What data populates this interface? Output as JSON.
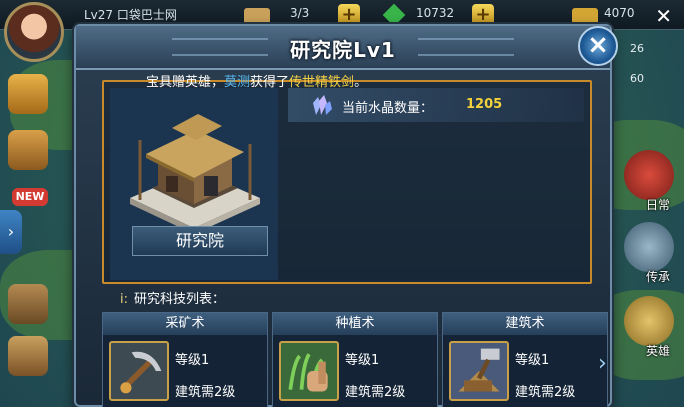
{
  "hud": {
    "level_text": "Lv27 口袋巴士网",
    "stamina": "3/3",
    "gems": "10732",
    "gold": "4070",
    "right_counts": [
      "26",
      "60"
    ]
  },
  "left_sidebar": {
    "new_badge": "NEW",
    "expand_arrow": "›"
  },
  "right_sidebar": {
    "labels": [
      "日常",
      "传承",
      "英雄"
    ]
  },
  "modal": {
    "title": "研究院Lv1",
    "close_icon": "×",
    "ticker": {
      "prefix": "宝具赠英雄，",
      "player": "莫测",
      "middle": "获得了",
      "item": "传世精铁剑",
      "suffix": "。"
    },
    "building": {
      "name": "研究院"
    },
    "crystal": {
      "label": "当前水晶数量：",
      "value": "1205"
    },
    "tech_list": {
      "prefix": "i:",
      "label": "研究科技列表：",
      "items": [
        {
          "name": "采矿术",
          "level": "等级1",
          "requirement": "建筑需2级",
          "icon": "pickaxe-icon"
        },
        {
          "name": "种植术",
          "level": "等级1",
          "requirement": "建筑需2级",
          "icon": "sprout-icon"
        },
        {
          "name": "建筑术",
          "level": "等级1",
          "requirement": "建筑需2级",
          "icon": "hammer-icon"
        }
      ],
      "next_arrow": "›"
    }
  },
  "colors": {
    "accent_gold": "#f4d23b",
    "player_blue": "#57b8f0",
    "panel_border": "#c98b2a"
  }
}
